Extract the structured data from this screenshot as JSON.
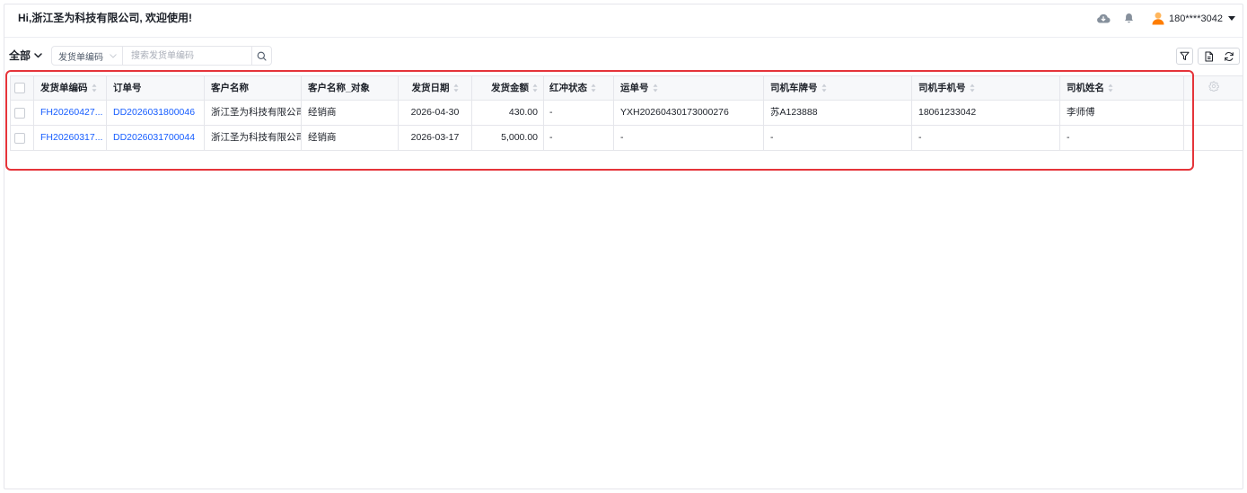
{
  "header": {
    "greeting": "Hi,浙江圣为科技有限公司, 欢迎使用!",
    "user_phone": "180****3042",
    "icons": [
      "cloud-download-icon",
      "bell-icon",
      "avatar-icon",
      "caret-down-icon"
    ]
  },
  "toolbar": {
    "scope_label": "全部",
    "search_field": "发货单编码",
    "search_placeholder": "搜索发货单编码",
    "search_value": "",
    "icons": [
      "chevron-down-icon",
      "search-icon",
      "filter-icon",
      "export-icon",
      "refresh-icon"
    ]
  },
  "table": {
    "all_selected": false,
    "settings_icon": "gear-icon",
    "columns": [
      {
        "key": "shipment_code",
        "label": "发货单编码",
        "sortable": true
      },
      {
        "key": "order_no",
        "label": "订单号",
        "sortable": false
      },
      {
        "key": "customer_name",
        "label": "客户名称",
        "sortable": false
      },
      {
        "key": "customer_object",
        "label": "客户名称_对象",
        "sortable": false
      },
      {
        "key": "ship_date",
        "label": "发货日期",
        "sortable": true
      },
      {
        "key": "ship_amount",
        "label": "发货金额",
        "sortable": true
      },
      {
        "key": "red_reversal_status",
        "label": "红冲状态",
        "sortable": true
      },
      {
        "key": "waybill_no",
        "label": "运单号",
        "sortable": true
      },
      {
        "key": "driver_plate",
        "label": "司机车牌号",
        "sortable": true
      },
      {
        "key": "driver_phone",
        "label": "司机手机号",
        "sortable": true
      },
      {
        "key": "driver_name",
        "label": "司机姓名",
        "sortable": true
      }
    ],
    "rows": [
      {
        "selected": false,
        "shipment_code": "FH20260427...",
        "order_no": "DD2026031800046",
        "customer_name": "浙江圣为科技有限公司",
        "customer_object": "经销商",
        "ship_date": "2026-04-30",
        "ship_amount": "430.00",
        "red_reversal_status": "-",
        "waybill_no": "YXH20260430173000276",
        "driver_plate": "苏A123888",
        "driver_phone": "18061233042",
        "driver_name": "李师傅"
      },
      {
        "selected": false,
        "shipment_code": "FH20260317...",
        "order_no": "DD2026031700044",
        "customer_name": "浙江圣为科技有限公司",
        "customer_object": "经销商",
        "ship_date": "2026-03-17",
        "ship_amount": "5,000.00",
        "red_reversal_status": "-",
        "waybill_no": "-",
        "driver_plate": "-",
        "driver_phone": "-",
        "driver_name": "-"
      }
    ]
  },
  "colors": {
    "text": "#1d2129",
    "link": "#165dff",
    "border": "#e5e6eb",
    "header_bg": "#f7f8fa",
    "muted": "#86909c",
    "avatar": "#ff7d00",
    "highlight": "#e5343a"
  }
}
